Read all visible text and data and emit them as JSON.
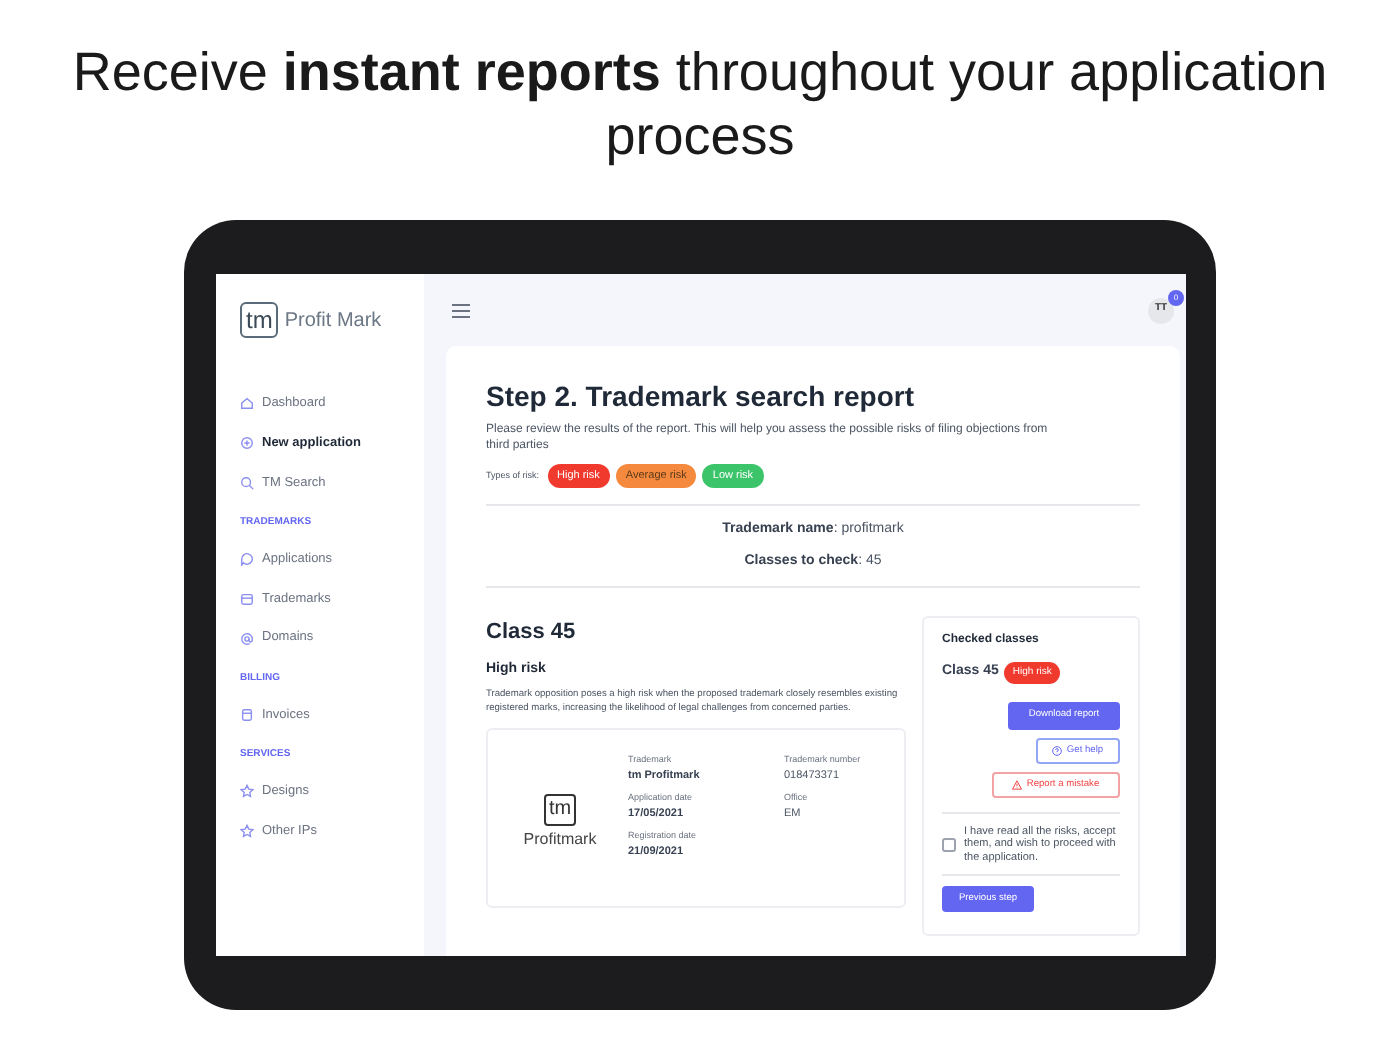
{
  "headline": "Receive **instant reports** throughout your application process",
  "sidebar": {
    "logo_mark": "tm",
    "logo_text": "Profit Mark",
    "groups": [
      {
        "items": [
          {
            "label": "Dashboard",
            "selected": false
          },
          {
            "label": "New application",
            "selected": true
          },
          {
            "label": "TM Search",
            "selected": false
          }
        ]
      },
      {
        "heading": "TRADEMARKS",
        "items": [
          {
            "label": "Applications",
            "selected": false
          },
          {
            "label": "Trademarks",
            "selected": false
          },
          {
            "label": "Domains",
            "selected": false
          }
        ]
      },
      {
        "heading": "BILLING",
        "items": [
          {
            "label": "Invoices",
            "selected": false
          }
        ]
      },
      {
        "heading": "SERVICES",
        "items": [
          {
            "label": "Designs",
            "selected": false
          },
          {
            "label": "Other IPs",
            "selected": false
          }
        ]
      }
    ]
  },
  "header": {
    "avatar": "TT",
    "notification_count": "0"
  },
  "report": {
    "title": "Step 2. Trademark search report",
    "description": "Please review the results of the report. This will help you assess the possible risks of filing objections from third parties",
    "risk_label": "Types of risk:",
    "risk_types": [
      {
        "label": "High risk",
        "color": "#f03a2e"
      },
      {
        "label": "Average risk",
        "color": "#f5893d"
      },
      {
        "label": "Low risk",
        "color": "#3cc46a"
      }
    ],
    "trademark_name_label": "Trademark name",
    "trademark_name": ": profitmark",
    "classes_label": "Classes to check",
    "classes": ": 45",
    "class_title": "Class 45",
    "risk_title": "High risk",
    "risk_text": "Trademark opposition poses a high risk when the proposed trademark closely resembles existing registered marks, increasing the likelihood of legal challenges from concerned parties.",
    "mark": {
      "logo_mark": "tm",
      "logo_text": "Profitmark",
      "fields": [
        {
          "label": "Trademark",
          "value": "tm Profitmark",
          "bold": true
        },
        {
          "label": "Trademark number",
          "value": "018473371",
          "bold": false
        },
        {
          "label": "Application date",
          "value": "17/05/2021",
          "bold": true
        },
        {
          "label": "Office",
          "value": "EM",
          "bold": false
        },
        {
          "label": "Registration date",
          "value": "21/09/2021",
          "bold": true
        }
      ]
    },
    "checked": {
      "title": "Checked classes",
      "class": "Class 45",
      "badge": "High risk",
      "download": "Download report",
      "help": "Get help",
      "mistake": "Report a mistake",
      "consent": "I have read all the risks, accept them, and wish to proceed with the application.",
      "consent_checked": false,
      "previous": "Previous step"
    }
  }
}
